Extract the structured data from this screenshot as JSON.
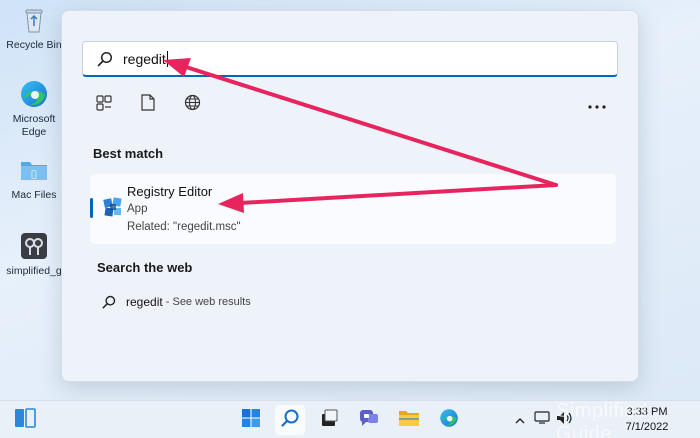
{
  "desktop": {
    "icons": [
      {
        "label": "Recycle Bin",
        "icon": "recycle-bin-icon"
      },
      {
        "label": "Microsoft Edge",
        "icon": "edge-icon"
      },
      {
        "label": "Mac Files",
        "icon": "folder-icon"
      },
      {
        "label": "simplified_g",
        "icon": "app-shortcut-icon"
      }
    ]
  },
  "start": {
    "search": {
      "value": "regedit",
      "icon": "search-icon"
    },
    "filters": [
      {
        "icon": "apps-filter-icon"
      },
      {
        "icon": "documents-filter-icon"
      },
      {
        "icon": "web-filter-icon"
      }
    ],
    "more_icon": "more-options-icon",
    "best_match": {
      "heading": "Best match",
      "name": "Registry Editor",
      "type": "App",
      "related": "Related: \"regedit.msc\"",
      "icon": "registry-editor-icon"
    },
    "web": {
      "heading": "Search the web",
      "query": "regedit",
      "suffix": " - See web results",
      "icon": "search-icon"
    }
  },
  "taskbar": {
    "apps": [
      {
        "name": "widgets",
        "icon": "widgets-icon"
      },
      {
        "name": "start",
        "icon": "windows-start-icon"
      },
      {
        "name": "search",
        "icon": "search-icon",
        "active": true
      },
      {
        "name": "task-view",
        "icon": "task-view-icon"
      },
      {
        "name": "chat",
        "icon": "teams-chat-icon"
      },
      {
        "name": "file-explorer",
        "icon": "folder-icon"
      },
      {
        "name": "edge",
        "icon": "edge-icon"
      }
    ],
    "tray_icons": [
      "chevron-up-icon",
      "display-icon",
      "volume-icon"
    ],
    "time": "3:33 PM",
    "date": "7/1/2022"
  },
  "watermark": "Simplified Guide",
  "colors": {
    "accent": "#0067c0",
    "arrow": "#e8245e"
  }
}
